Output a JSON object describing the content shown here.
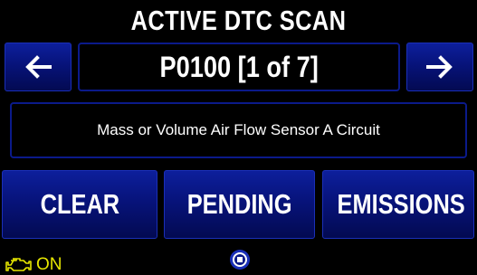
{
  "screen": {
    "title": "ACTIVE DTC SCAN"
  },
  "dtc": {
    "code_label": "P0100 [1 of 7]",
    "description": "Mass or Volume Air Flow Sensor A Circuit"
  },
  "nav": {
    "prev_icon": "arrow-left-icon",
    "next_icon": "arrow-right-icon"
  },
  "actions": {
    "clear_label": "CLEAR",
    "pending_label": "PENDING",
    "emissions_label": "EMISSIONS"
  },
  "status": {
    "engine_icon": "check-engine-icon",
    "mil_label": "ON",
    "mil_color": "#e6e600"
  },
  "footer": {
    "home_icon": "home-button-icon"
  },
  "colors": {
    "button_blue": "#07137a",
    "border_blue": "#0b1a8a",
    "background": "#000000"
  }
}
